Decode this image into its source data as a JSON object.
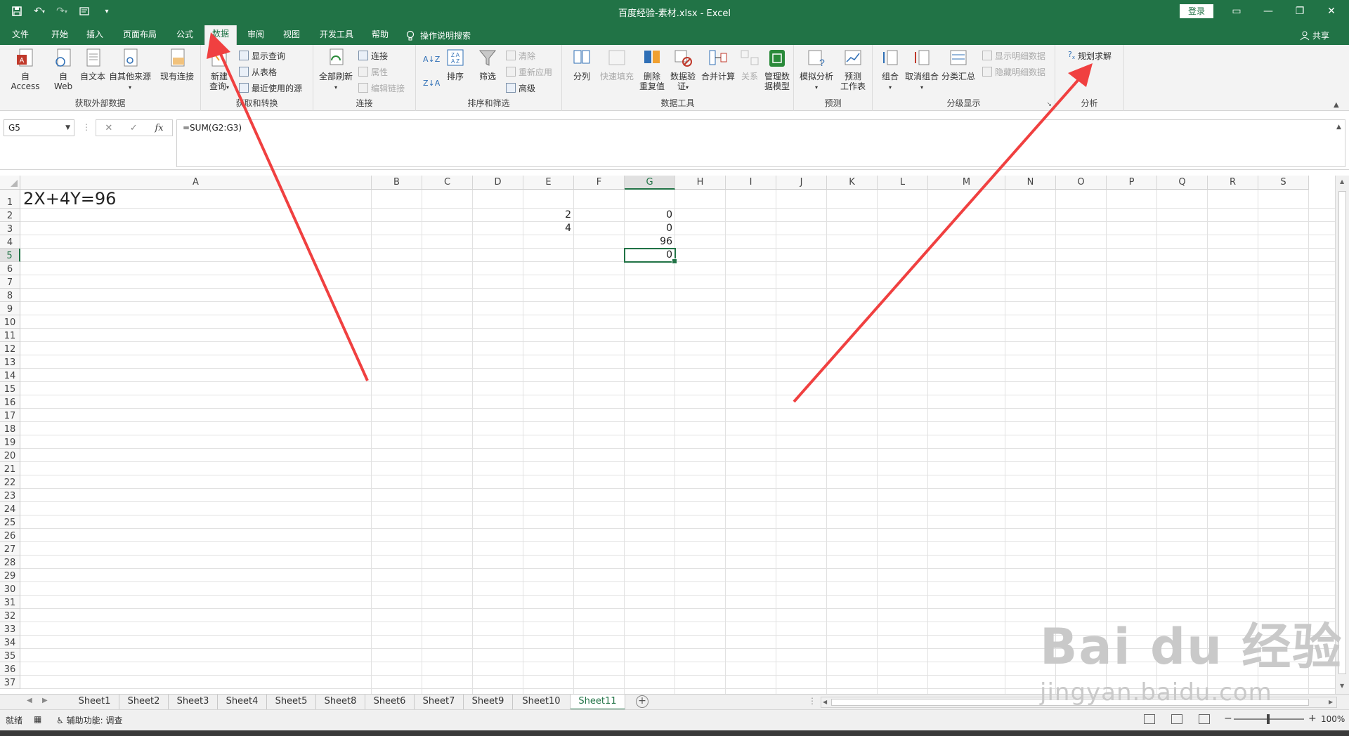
{
  "app": {
    "title": "百度经验-素材.xlsx  -  Excel",
    "login": "登录",
    "share": "共享"
  },
  "qat": [
    "save",
    "undo",
    "redo",
    "form"
  ],
  "tabs": [
    "文件",
    "开始",
    "插入",
    "页面布局",
    "公式",
    "数据",
    "审阅",
    "视图",
    "开发工具",
    "帮助"
  ],
  "active_tab": "数据",
  "tellme": "操作说明搜索",
  "ribbon": {
    "groups": {
      "external": "获取外部数据",
      "transform": "获取和转换",
      "connections": "连接",
      "sortfilter": "排序和筛选",
      "datatools": "数据工具",
      "forecast": "预测",
      "outline": "分级显示",
      "analysis": "分析"
    },
    "buttons": {
      "access": "自 Access",
      "web1": "自",
      "web2": "Web",
      "text": "自文本",
      "other": "自其他来源",
      "existing": "现有连接",
      "newquery1": "新建",
      "newquery2": "查询",
      "showquery": "显示查询",
      "fromtable": "从表格",
      "recent": "最近使用的源",
      "refreshall": "全部刷新",
      "connections": "连接",
      "properties": "属性",
      "editlinks": "编辑链接",
      "sort": "排序",
      "filter": "筛选",
      "clear": "清除",
      "reapply": "重新应用",
      "advanced": "高级",
      "texttocol": "分列",
      "flashfill": "快速填充",
      "removedup1": "删除",
      "removedup2": "重复值",
      "validation1": "数据验",
      "validation2": "证",
      "consolidate": "合并计算",
      "relations": "关系",
      "datamodel1": "管理数",
      "datamodel2": "据模型",
      "whatif": "模拟分析",
      "forecast1": "预测",
      "forecast2": "工作表",
      "group": "组合",
      "ungroup": "取消组合",
      "subtotal": "分类汇总",
      "showdetail": "显示明细数据",
      "hidedetail": "隐藏明细数据",
      "solver": "规划求解"
    }
  },
  "formula_bar": {
    "namebox": "G5",
    "formula": "=SUM(G2:G3)"
  },
  "columns": [
    "A",
    "B",
    "C",
    "D",
    "E",
    "F",
    "G",
    "H",
    "I",
    "J",
    "K",
    "L",
    "M",
    "N",
    "O",
    "P",
    "Q",
    "R",
    "S"
  ],
  "rows": [
    "1",
    "2",
    "3",
    "4",
    "5",
    "6",
    "7",
    "8",
    "9",
    "10",
    "11",
    "12",
    "13",
    "14",
    "15",
    "16",
    "17",
    "18",
    "19",
    "20",
    "21",
    "22",
    "23",
    "24",
    "25",
    "26",
    "27",
    "28",
    "29",
    "30",
    "31",
    "32",
    "33",
    "34",
    "35",
    "36",
    "37"
  ],
  "cells": {
    "A1": "2X+4Y=96",
    "E2": "2",
    "E3": "4",
    "G2": "0",
    "G3": "0",
    "G4": "96",
    "G5": "0"
  },
  "selected_cell": "G5",
  "sheets": [
    "Sheet1",
    "Sheet2",
    "Sheet3",
    "Sheet4",
    "Sheet5",
    "Sheet8",
    "Sheet6",
    "Sheet7",
    "Sheet9",
    "Sheet10",
    "Sheet11"
  ],
  "active_sheet": "Sheet11",
  "status": {
    "ready": "就绪",
    "accessibility": "辅助功能: 调查",
    "zoom": "100%"
  },
  "watermark": {
    "brand": "Bai du 经验",
    "url": "jingyan.baidu.com"
  },
  "colors": {
    "accent": "#217346",
    "arrow": "#f04040"
  }
}
